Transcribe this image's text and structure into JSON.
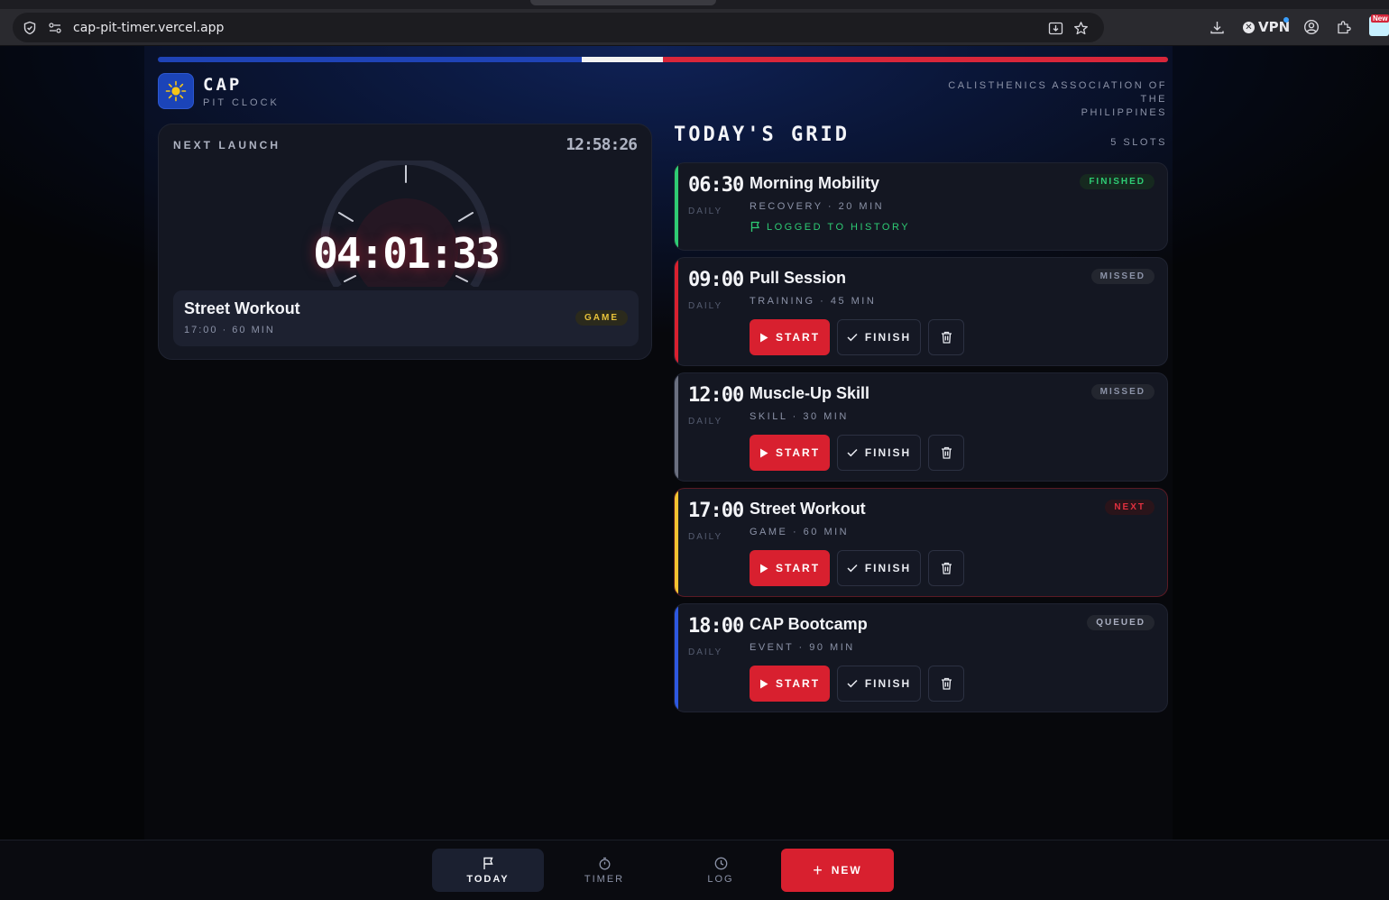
{
  "browser": {
    "url": "cap-pit-timer.vercel.app",
    "vpn_label": "VPN",
    "extension_badge": "New"
  },
  "header": {
    "brand_title": "CAP",
    "brand_subtitle": "PIT CLOCK",
    "org_line1": "CALISTHENICS ASSOCIATION OF THE",
    "org_line2": "PHILIPPINES"
  },
  "launch": {
    "label": "NEXT LAUNCH",
    "clock": "12:58:26",
    "countdown": "04:01:33",
    "event_name": "Street Workout",
    "event_meta": "17:00 · 60 MIN",
    "event_badge": "GAME"
  },
  "grid": {
    "title": "TODAY'S GRID",
    "count": "5 SLOTS",
    "start_label": "START",
    "finish_label": "FINISH",
    "slots": [
      {
        "time": "06:30",
        "freq": "DAILY",
        "name": "Morning Mobility",
        "meta": "RECOVERY · 20 MIN",
        "status": "FINISHED",
        "note": "LOGGED TO HISTORY",
        "accent": "#2ecb74"
      },
      {
        "time": "09:00",
        "freq": "DAILY",
        "name": "Pull Session",
        "meta": "TRAINING · 45 MIN",
        "status": "MISSED",
        "accent": "#d8202f"
      },
      {
        "time": "12:00",
        "freq": "DAILY",
        "name": "Muscle-Up Skill",
        "meta": "SKILL · 30 MIN",
        "status": "MISSED",
        "accent": "#6b7080"
      },
      {
        "time": "17:00",
        "freq": "DAILY",
        "name": "Street Workout",
        "meta": "GAME · 60 MIN",
        "status": "NEXT",
        "accent": "#f2c230"
      },
      {
        "time": "18:00",
        "freq": "DAILY",
        "name": "CAP Bootcamp",
        "meta": "EVENT · 90 MIN",
        "status": "QUEUED",
        "accent": "#2d58e0"
      }
    ]
  },
  "nav": {
    "today": "TODAY",
    "timer": "TIMER",
    "log": "LOG",
    "new": "NEW"
  },
  "colors": {
    "brand_red": "#d8202f",
    "brand_blue": "#1f43b6",
    "finished_green": "#2ecb74",
    "game_yellow": "#e8c23a"
  }
}
